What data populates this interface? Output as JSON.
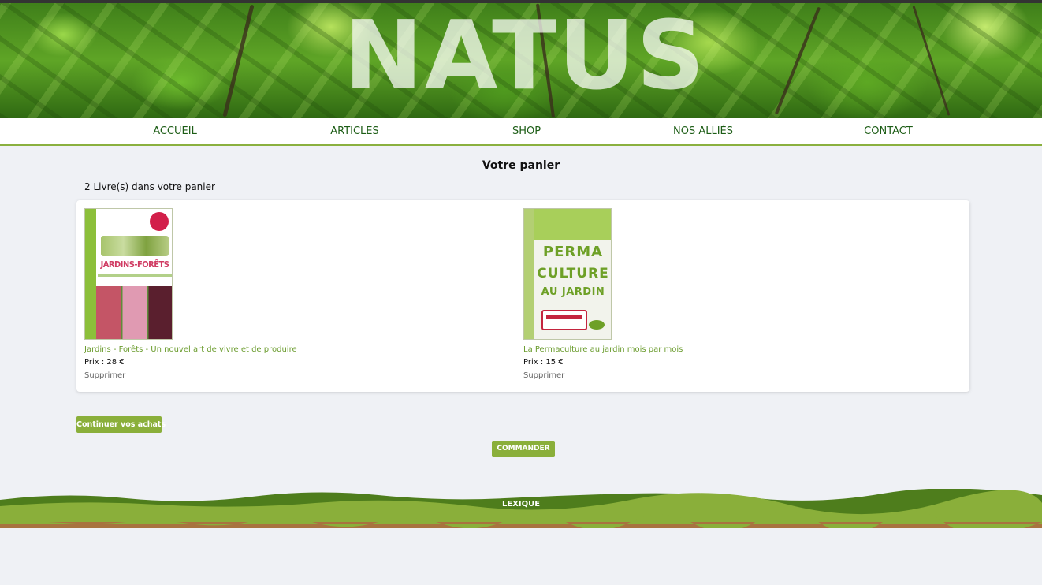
{
  "site": {
    "brand": "NATUS"
  },
  "nav": {
    "items": [
      {
        "label": "ACCUEIL"
      },
      {
        "label": "ARTICLES"
      },
      {
        "label": "SHOP"
      },
      {
        "label": "NOS ALLIÉS"
      },
      {
        "label": "CONTACT"
      }
    ]
  },
  "cart": {
    "title": "Votre panier",
    "count_text": "2 Livre(s) dans votre panier",
    "items": [
      {
        "title": "Jardins - Forêts - Un nouvel art de vivre et de produire",
        "price": "Prix : 28 €",
        "remove_label": "Supprimer",
        "cover_title": "JARDINS-FORÊTS"
      },
      {
        "title": "La Permaculture au jardin mois par mois",
        "price": "Prix : 15 €",
        "remove_label": "Supprimer",
        "cover_line1": "PERMA",
        "cover_line2": "CULTURE",
        "cover_line3": "AU JARDIN"
      }
    ],
    "continue_label": "Continuer vos achats",
    "order_label": "COMMANDER"
  },
  "footer": {
    "link_label": "LEXIQUE"
  },
  "colors": {
    "accent_green": "#8aaf3a",
    "nav_text": "#1d5d16",
    "background": "#eff1f5"
  }
}
